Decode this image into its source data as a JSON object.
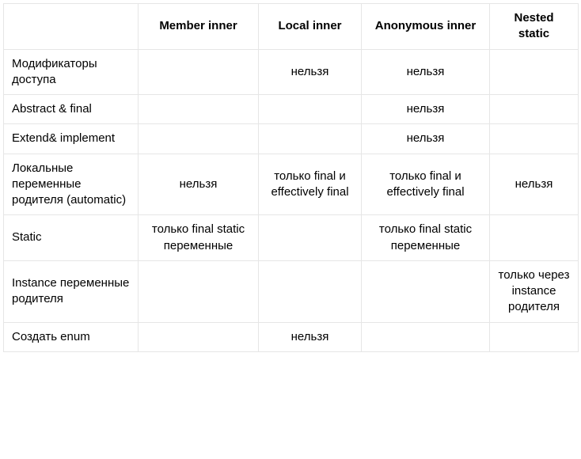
{
  "chart_data": {
    "type": "table",
    "columns": [
      "",
      "Member inner",
      "Local inner",
      "Anonymous inner",
      "Nested static"
    ],
    "rows": [
      {
        "label": "Модификаторы доступа",
        "cells": [
          "",
          "нельзя",
          "нельзя",
          ""
        ]
      },
      {
        "label": "Abstract & final",
        "cells": [
          "",
          "",
          "нельзя",
          ""
        ]
      },
      {
        "label": "Extend& implement",
        "cells": [
          "",
          "",
          "нельзя",
          ""
        ]
      },
      {
        "label": "Локальные переменные родителя (automatic)",
        "cells": [
          "нельзя",
          "только final и effectively final",
          "только final и effectively final",
          "нельзя"
        ]
      },
      {
        "label": "Static",
        "cells": [
          "только final static переменные",
          "",
          "только final static переменные",
          ""
        ]
      },
      {
        "label": "Instance переменные родителя",
        "cells": [
          "",
          "",
          "",
          "только через instance родителя"
        ]
      },
      {
        "label": "Создать enum",
        "cells": [
          "",
          "нельзя",
          "",
          ""
        ]
      }
    ]
  }
}
